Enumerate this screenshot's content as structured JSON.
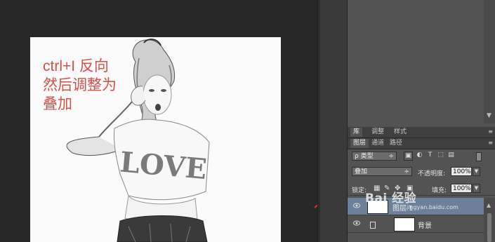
{
  "canvas": {
    "annotation": "ctrl+I 反向\n然后调整为\n叠加",
    "shirt_text": "LOVE"
  },
  "panel_tabs_top": [
    {
      "label": "库",
      "active": true
    },
    {
      "label": "调整",
      "active": false
    },
    {
      "label": "样式",
      "active": false
    }
  ],
  "panel_tabs_layers": [
    {
      "label": "图层",
      "active": true
    },
    {
      "label": "通道",
      "active": false
    },
    {
      "label": "路径",
      "active": false
    }
  ],
  "filter": {
    "kind_label": "ρ 类型",
    "icons": [
      "image-filter-icon",
      "adjust-filter-icon",
      "text-filter-icon",
      "shape-filter-icon",
      "smart-filter-icon"
    ]
  },
  "blend": {
    "mode": "叠加",
    "opacity_label": "不透明度:",
    "opacity_value": "100%"
  },
  "lock": {
    "label": "锁定:",
    "fill_label": "填充:",
    "fill_value": "100%"
  },
  "layers": [
    {
      "name": "图层 1",
      "selected": true
    },
    {
      "name": "背景",
      "selected": false
    }
  ],
  "watermark": {
    "text": "Bai 经验",
    "sub": "jingyan.baidu.com"
  }
}
